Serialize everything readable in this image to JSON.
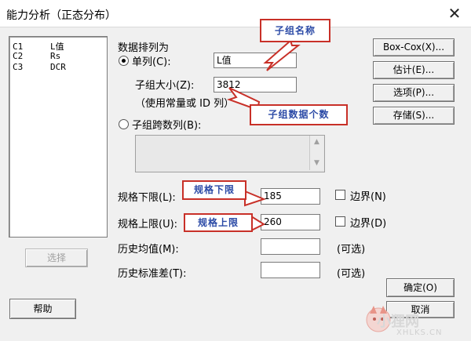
{
  "window": {
    "title": "能力分析（正态分布）",
    "close_glyph": "✕"
  },
  "columns": [
    {
      "num": "C1",
      "name": "L值"
    },
    {
      "num": "C2",
      "name": "Rs"
    },
    {
      "num": "C3",
      "name": "DCR"
    }
  ],
  "data_arrangement": {
    "group_label": "数据排列为",
    "single_column_label": "单列(C):",
    "single_column_value": "L值",
    "single_column_selected": true,
    "subgroup_size_label": "子组大小(Z):",
    "subgroup_size_value": "3812",
    "subgroup_size_hint": "（使用常量或 ID 列）",
    "across_columns_label": "子组跨数列(B):",
    "across_columns_selected": false
  },
  "spec": {
    "lower_label": "规格下限(L):",
    "lower_value": "185",
    "lower_boundary_label": "边界(N)",
    "upper_label": "规格上限(U):",
    "upper_value": "260",
    "upper_boundary_label": "边界(D)"
  },
  "history": {
    "mean_label": "历史均值(M):",
    "mean_value": "",
    "mean_optional": "(可选)",
    "std_label": "历史标准差(T):",
    "std_value": "",
    "std_optional": "(可选)"
  },
  "buttons": {
    "boxcox": "Box-Cox(X)...",
    "estimate": "估计(E)...",
    "options": "选项(P)...",
    "storage": "存储(S)...",
    "select": "选择",
    "help": "帮助",
    "ok": "确定(O)",
    "cancel": "取消"
  },
  "callouts": {
    "subgroup_name": "子组名称",
    "subgroup_count": "子组数据个数",
    "lower_limit": "规格下限",
    "upper_limit": "规格上限"
  },
  "watermark": {
    "text": "小狸网",
    "url": "XHLKS.CN"
  },
  "colors": {
    "callout_border": "#c83028",
    "callout_text": "#2b4aa6"
  }
}
